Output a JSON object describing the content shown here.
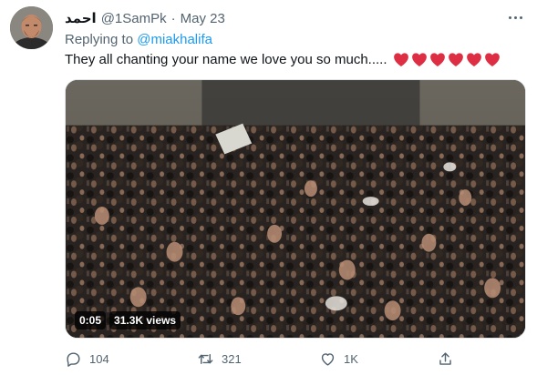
{
  "tweet": {
    "author_name": "احمد",
    "author_handle": "@1SamPk",
    "separator": "·",
    "date": "May 23",
    "replying_prefix": "Replying to",
    "replying_mention": "@miakhalifa",
    "text": "They all chanting your name we love you so much.....",
    "heart_count": 6,
    "media": {
      "timestamp": "0:05",
      "views": "31.3K views"
    },
    "actions": {
      "reply_count": "104",
      "retweet_count": "321",
      "like_count": "1K"
    }
  },
  "icons": {
    "avatar": "avatar",
    "more": "more-icon",
    "heart_emoji": "red-heart-emoji",
    "reply": "reply-icon",
    "retweet": "retweet-icon",
    "like": "like-icon",
    "share": "share-icon"
  },
  "colors": {
    "link": "#1d9bf0",
    "secondary_text": "#536471",
    "primary_text": "#0f1419",
    "heart": "#dd2e44"
  }
}
